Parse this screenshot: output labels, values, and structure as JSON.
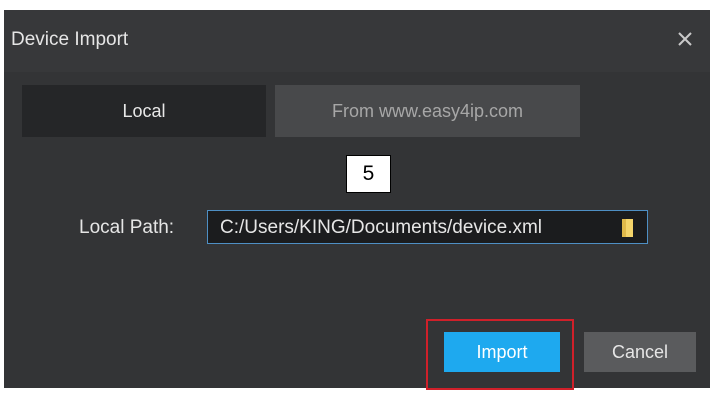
{
  "dialog": {
    "title": "Device Import",
    "close_icon": "close-icon"
  },
  "tabs": [
    {
      "label": "Local",
      "active": true
    },
    {
      "label": "From www.easy4ip.com",
      "active": false
    }
  ],
  "annotation": {
    "step_number": "5",
    "highlight_color": "#d0202a"
  },
  "form": {
    "local_path_label": "Local Path:",
    "local_path_value": "C:/Users/KING/Documents/device.xml",
    "browse_icon": "folder-icon"
  },
  "buttons": {
    "import_label": "Import",
    "cancel_label": "Cancel"
  },
  "colors": {
    "accent": "#1ea9ef",
    "background": "#333436",
    "folder": "#f4d46a"
  }
}
